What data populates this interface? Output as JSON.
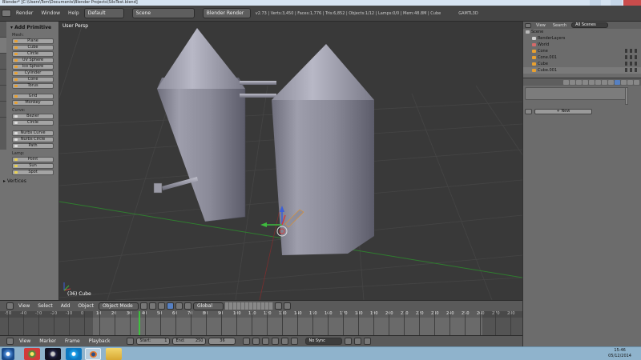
{
  "window": {
    "title": "Blender* [C:\\Users\\Tom\\Documents\\Blender Projects\\SiloTest.blend]"
  },
  "infobar": {
    "menus": [
      "Render",
      "Window",
      "Help"
    ],
    "screen_layout": "Default",
    "scene": "Scene",
    "render_engine": "Blender Render",
    "stats": "v2.73 | Verts:3,450 | Faces:1,776 | Tris:6,852 | Objects:1/12 | Lamps:0/0 | Mem:48.8M | Cube",
    "gamtl": "GAMTL3D"
  },
  "toolshelf": {
    "title": "Add Primitive",
    "groups": {
      "mesh": "Mesh:",
      "curve": "Curve:",
      "lamp": "Lamp:"
    },
    "mesh_items": [
      "Plane",
      "Cube",
      "Circle",
      "UV Sphere",
      "Ico Sphere",
      "Cylinder",
      "Cone",
      "Torus"
    ],
    "mesh_items2": [
      "Grid",
      "Monkey"
    ],
    "curve_items": [
      "Bezier",
      "Circle"
    ],
    "curve_items2": [
      "Nurbs Curve",
      "Nurbs Circle",
      "Path"
    ],
    "lamp_items": [
      "Point",
      "Sun",
      "Spot"
    ],
    "bottom_panel": "Vertices"
  },
  "viewport": {
    "view_label": "User Persp",
    "object_label": "(36) Cube"
  },
  "view3d_header": {
    "menus": [
      "View",
      "Select",
      "Add",
      "Object"
    ],
    "mode": "Object Mode",
    "orientation": "Global"
  },
  "timeline": {
    "ruler_ticks": [
      "-50",
      "-40",
      "-30",
      "-20",
      "-10",
      "0",
      "10",
      "20",
      "30",
      "40",
      "50",
      "60",
      "70",
      "80",
      "90",
      "100",
      "110",
      "120",
      "130",
      "140",
      "150",
      "160",
      "170",
      "180",
      "190",
      "200",
      "210",
      "220",
      "230",
      "240",
      "250",
      "260",
      "270",
      "280"
    ],
    "current_frame": 36,
    "header": {
      "menus": [
        "View",
        "Marker",
        "Frame",
        "Playback"
      ],
      "start_label": "Start:",
      "start_value": "1",
      "end_label": "End:",
      "end_value": "250",
      "current_value": "36",
      "sync": "No Sync"
    }
  },
  "outliner": {
    "view_menu": "View",
    "search_menu": "Search",
    "display_mode": "All Scenes",
    "rows": [
      {
        "label": "Scene",
        "icon_color": "#b8b8b8",
        "indent": 0
      },
      {
        "label": "RenderLayers",
        "icon_color": "#d0d0d0",
        "indent": 1
      },
      {
        "label": "World",
        "icon_color": "#d46a6a",
        "indent": 1
      },
      {
        "label": "Cone",
        "icon_color": "#e8a030",
        "indent": 1
      },
      {
        "label": "Cone.001",
        "icon_color": "#e8a030",
        "indent": 1
      },
      {
        "label": "Cube",
        "icon_color": "#e8a030",
        "indent": 1
      },
      {
        "label": "Cube.001",
        "icon_color": "#e8a030",
        "indent": 1
      }
    ]
  },
  "properties": {
    "new_button": "New"
  },
  "taskbar": {
    "time": "15:46",
    "date": "05/12/2014"
  }
}
